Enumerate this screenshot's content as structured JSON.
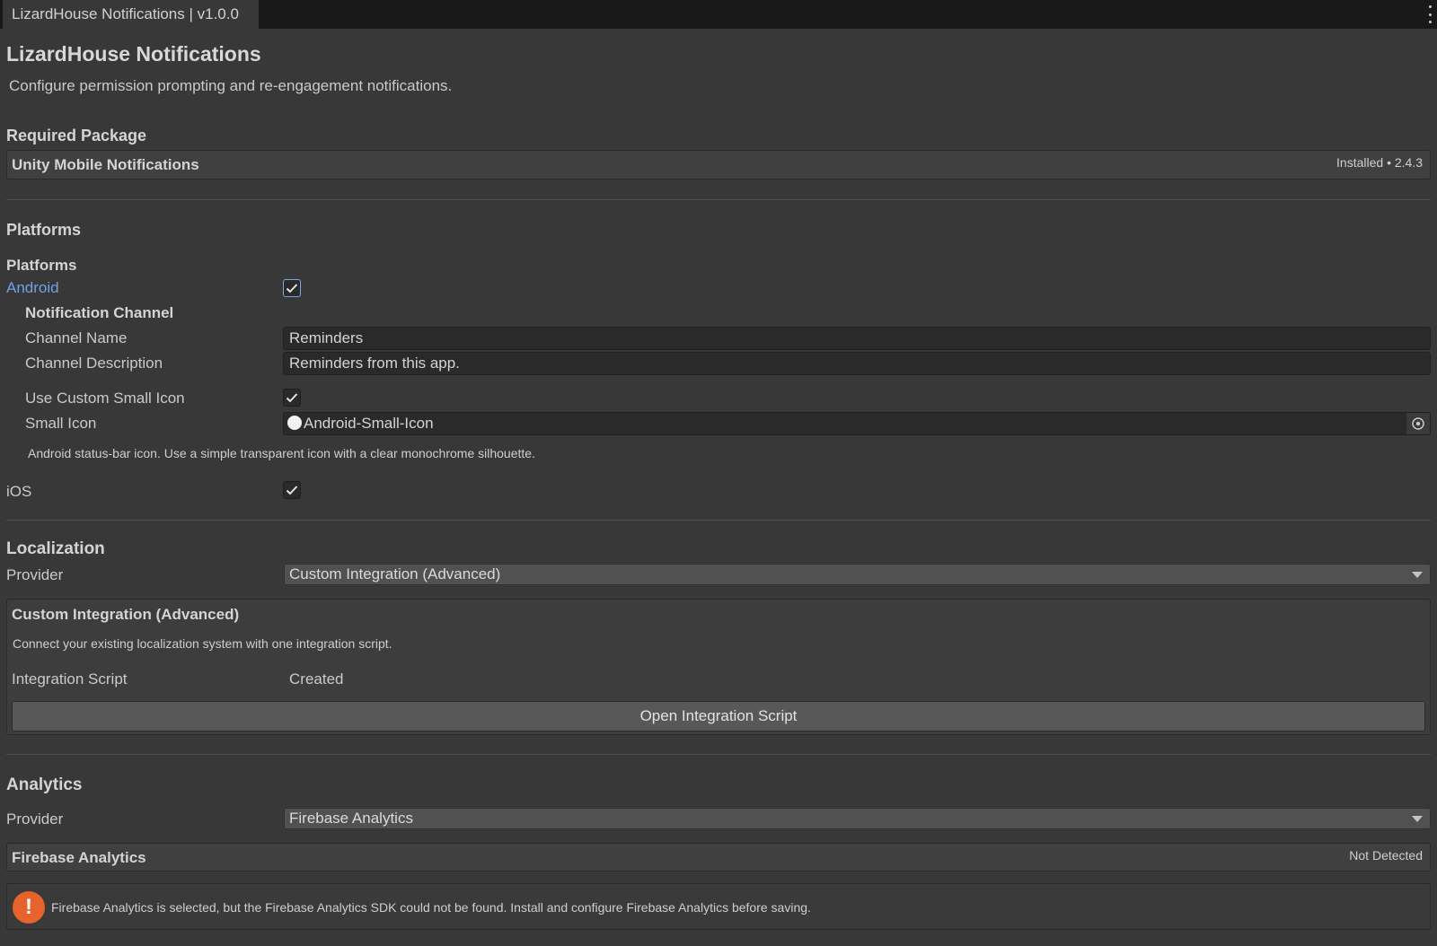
{
  "window": {
    "tab_title": "LizardHouse Notifications | v1.0.0"
  },
  "header": {
    "title": "LizardHouse Notifications",
    "subtitle": "Configure permission prompting and re-engagement notifications."
  },
  "required_package": {
    "heading": "Required Package",
    "name": "Unity Mobile Notifications",
    "status": "Installed • 2.4.3"
  },
  "platforms": {
    "section_heading": "Platforms",
    "group_label": "Platforms",
    "android": {
      "label": "Android",
      "checked": true,
      "notification_channel": {
        "heading": "Notification Channel",
        "channel_name_label": "Channel Name",
        "channel_name_value": "Reminders",
        "channel_description_label": "Channel Description",
        "channel_description_value": "Reminders from this app.",
        "use_custom_small_icon_label": "Use Custom Small Icon",
        "use_custom_small_icon_checked": true,
        "small_icon_label": "Small Icon",
        "small_icon_value": "Android-Small-Icon",
        "help_text": "Android status-bar icon. Use a simple transparent icon with a clear monochrome silhouette."
      }
    },
    "ios": {
      "label": "iOS",
      "checked": true
    }
  },
  "localization": {
    "heading": "Localization",
    "provider_label": "Provider",
    "provider_value": "Custom Integration (Advanced)",
    "panel": {
      "title": "Custom Integration (Advanced)",
      "description": "Connect your existing localization system with one integration script.",
      "integration_script_label": "Integration Script",
      "integration_script_value": "Created",
      "open_button_label": "Open Integration Script"
    }
  },
  "analytics": {
    "heading": "Analytics",
    "provider_label": "Provider",
    "provider_value": "Firebase Analytics",
    "panel": {
      "title": "Firebase Analytics",
      "status": "Not Detected"
    },
    "warning": {
      "icon": "warning-icon",
      "message": "Firebase Analytics is selected, but the Firebase Analytics SDK could not be found. Install and configure Firebase Analytics before saving."
    }
  },
  "colors": {
    "background": "#383838",
    "link": "#6fa3e6",
    "warning": "#e8632b"
  }
}
